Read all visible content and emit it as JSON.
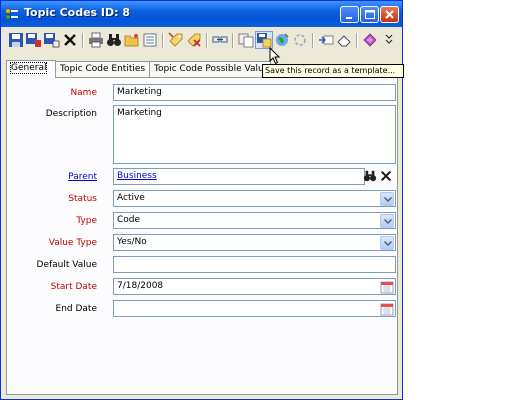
{
  "window": {
    "title": "Topic Codes ID: 8"
  },
  "toolbar": {
    "buttons": [
      "save-icon",
      "save-close-icon",
      "save-new-icon",
      "delete-icon",
      "print-icon",
      "find-icon",
      "open-folder-icon",
      "list-icon",
      "tag-icon",
      "tag-clear-icon",
      "link-icon",
      "copy-icon",
      "save-template-icon",
      "globe-icon",
      "refresh-icon",
      "insert-icon",
      "erase-icon",
      "palette-icon",
      "overflow-icon"
    ]
  },
  "tooltip": {
    "text": "Save this record as a template..."
  },
  "tabs": {
    "general": "General",
    "entities": "Topic Code Entities",
    "values": "Topic Code Possible Values"
  },
  "form": {
    "name_label": "Name",
    "name_value": "Marketing",
    "description_label": "Description",
    "description_value": "Marketing",
    "parent_label": "Parent",
    "parent_value": "Business",
    "status_label": "Status",
    "status_value": "Active",
    "type_label": "Type",
    "type_value": "Code",
    "value_type_label": "Value Type",
    "value_type_value": "Yes/No",
    "default_value_label": "Default Value",
    "default_value_value": "",
    "start_date_label": "Start Date",
    "start_date_value": "7/18/2008",
    "end_date_label": "End Date",
    "end_date_value": ""
  },
  "colors": {
    "title_bar": "#0a5fdf",
    "required_label": "#c00000",
    "link_label": "#0000cc"
  }
}
